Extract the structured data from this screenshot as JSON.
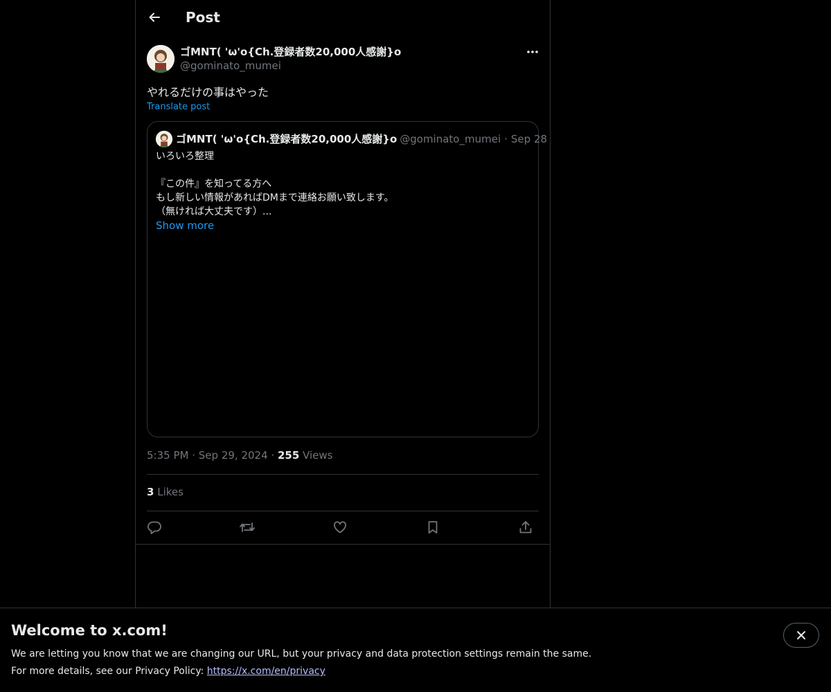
{
  "header": {
    "title": "Post"
  },
  "post": {
    "author_name": "ゴMNT( 'ω'o{Ch.登録者数20,000人感謝}o",
    "author_handle": "@gominato_mumei",
    "text": "やれるだけの事はやった",
    "translate_label": "Translate post",
    "time": "5:35 PM",
    "date": "Sep 29, 2024",
    "views_count": "255",
    "views_label": "Views",
    "likes_count": "3",
    "likes_label": "Likes"
  },
  "quote": {
    "author_name": "ゴMNT( 'ω'o{Ch.登録者数20,000人感謝}o",
    "author_handle": "@gominato_mumei",
    "date": "Sep 28",
    "lines": [
      "いろいろ整理",
      "",
      "『この件』を知ってる方へ",
      "もし新しい情報があればDMまで連絡お願い致します。",
      "（無ければ大丈夫です）..."
    ],
    "show_more": "Show more"
  },
  "banner": {
    "title": "Welcome to x.com!",
    "line1": "We are letting you know that we are changing our URL, but your privacy and data protection settings remain the same.",
    "line2_prefix": "For more details, see our Privacy Policy: ",
    "link": "https://x.com/en/privacy"
  },
  "icons": {
    "back": "arrow-left-icon",
    "more": "more-horizontal-icon",
    "reply": "reply-icon",
    "repost": "repost-icon",
    "like": "heart-icon",
    "bookmark": "bookmark-icon",
    "share": "share-icon",
    "close": "close-icon"
  },
  "colors": {
    "accent": "#1d9bf0",
    "text": "#e7e9ea",
    "secondary": "#71767b",
    "border": "#2f3336",
    "link_banner": "#b7bdff"
  }
}
